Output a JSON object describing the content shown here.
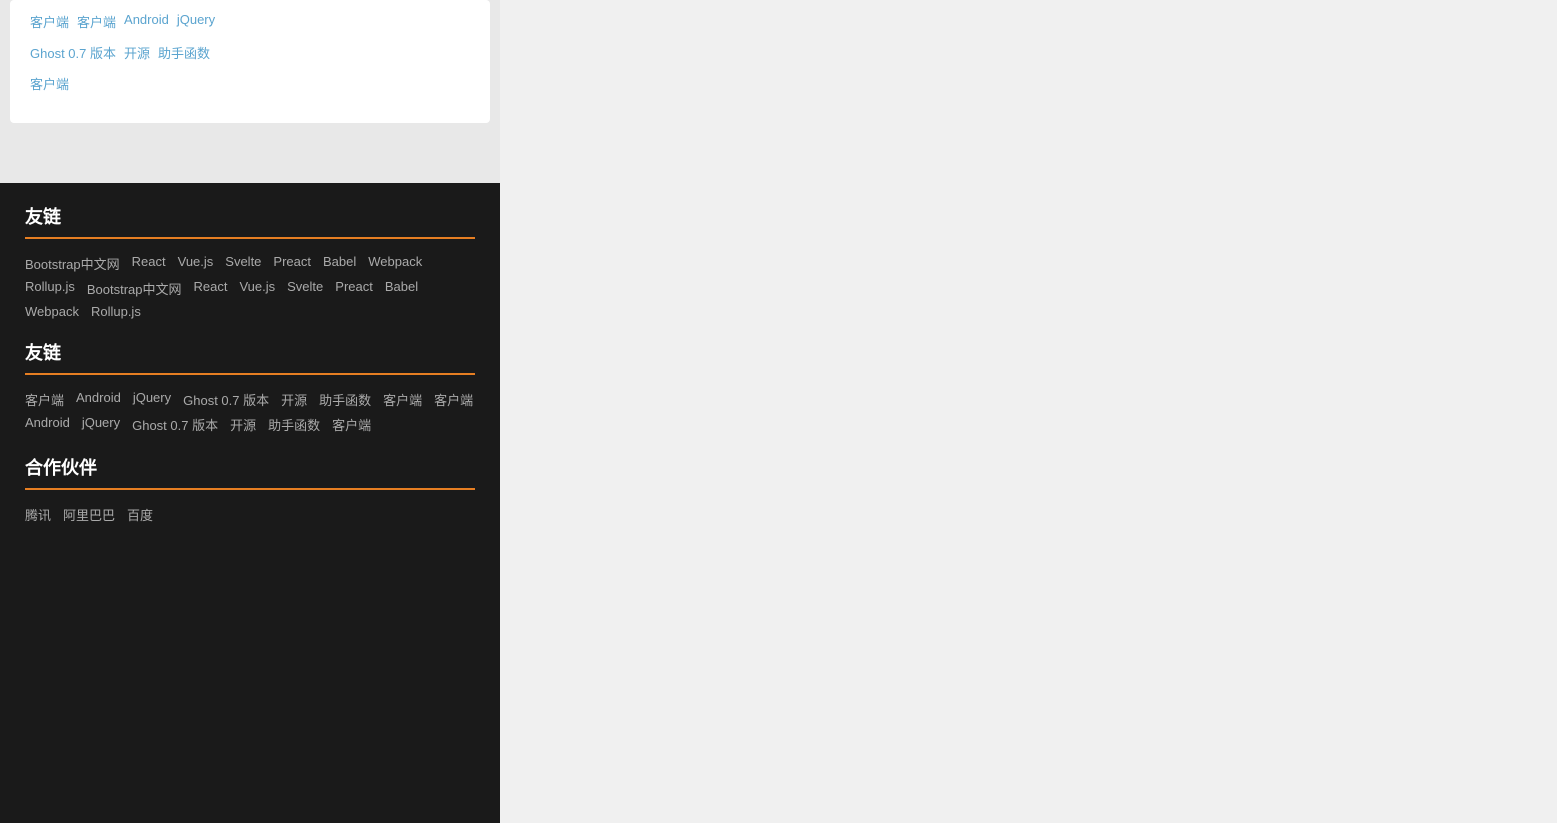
{
  "top_card": {
    "row1": [
      "客户端",
      "客户端",
      "Android",
      "jQuery"
    ],
    "row2": [
      "Ghost 0.7 版本",
      "开源",
      "助手函数"
    ],
    "row3": [
      "客户端"
    ]
  },
  "section1": {
    "title": "友链",
    "links_row1": [
      "Bootstrap中文网",
      "React",
      "Vue.js",
      "Svelte",
      "Preact",
      "Babel"
    ],
    "links_row2": [
      "Webpack",
      "Rollup.js",
      "Bootstrap中文网",
      "React",
      "Vue.js"
    ],
    "links_row3": [
      "Svelte",
      "Preact",
      "Babel",
      "Webpack",
      "Rollup.js"
    ]
  },
  "section2": {
    "title": "友链",
    "links_row1": [
      "客户端",
      "Android",
      "jQuery",
      "Ghost 0.7 版本",
      "开源",
      "助手函数"
    ],
    "links_row2": [
      "客户端",
      "客户端",
      "Android",
      "jQuery",
      "Ghost 0.7 版本",
      "开源"
    ],
    "links_row3": [
      "助手函数",
      "客户端"
    ]
  },
  "section3": {
    "title": "合作伙伴",
    "links_row1": [
      "腾讯",
      "阿里巴巴",
      "百度"
    ]
  }
}
